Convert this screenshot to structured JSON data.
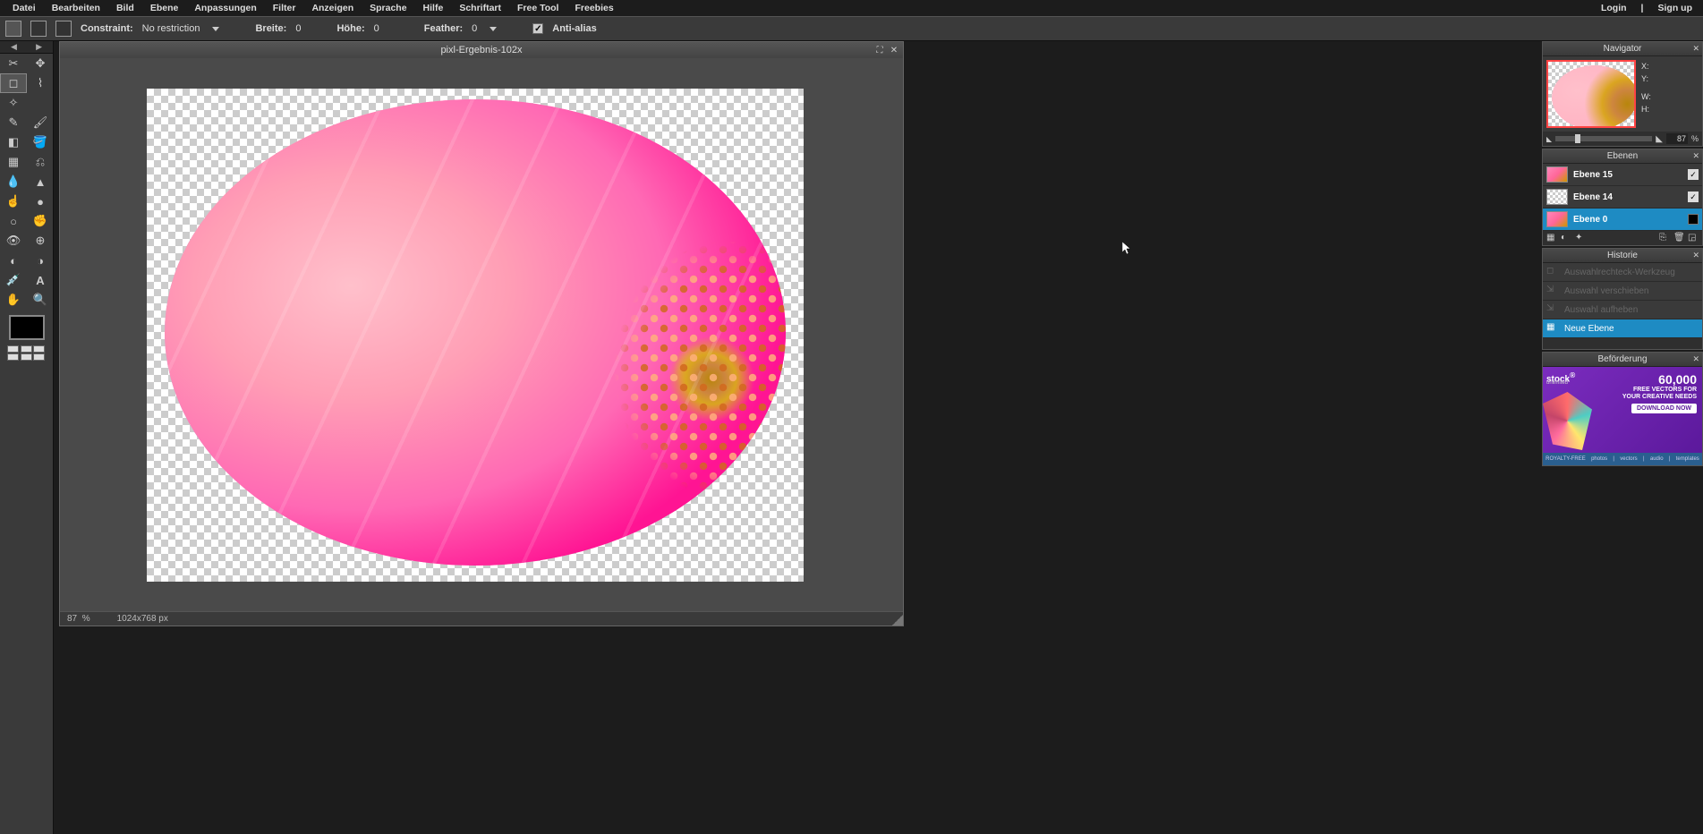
{
  "menubar": {
    "items": [
      "Datei",
      "Bearbeiten",
      "Bild",
      "Ebene",
      "Anpassungen",
      "Filter",
      "Anzeigen",
      "Sprache",
      "Hilfe",
      "Schriftart",
      "Free Tool",
      "Freebies"
    ],
    "login": "Login",
    "signup": "Sign up",
    "divider": "|"
  },
  "optionsbar": {
    "constraint_label": "Constraint:",
    "constraint_value": "No restriction",
    "width_label": "Breite:",
    "width_value": "0",
    "height_label": "Höhe:",
    "height_value": "0",
    "feather_label": "Feather:",
    "feather_value": "0",
    "antialias_label": "Anti-alias"
  },
  "document": {
    "title": "pixl-Ergebnis-102x",
    "zoom": "87",
    "zoom_unit": "%",
    "dimensions": "1024x768 px"
  },
  "panels": {
    "navigator": {
      "title": "Navigator",
      "x_label": "X:",
      "y_label": "Y:",
      "w_label": "W:",
      "h_label": "H:",
      "zoom": "87",
      "zoom_unit": "%"
    },
    "layers": {
      "title": "Ebenen",
      "items": [
        {
          "name": "Ebene 15",
          "visible": true,
          "selected": false,
          "thumb": "pink"
        },
        {
          "name": "Ebene 14",
          "visible": true,
          "selected": false,
          "thumb": "transparent"
        },
        {
          "name": "Ebene 0",
          "visible": true,
          "selected": true,
          "thumb": "pink",
          "solid": true
        }
      ]
    },
    "history": {
      "title": "Historie",
      "items": [
        {
          "label": "Auswahlrechteck-Werkzeug",
          "active": false
        },
        {
          "label": "Auswahl verschieben",
          "active": false
        },
        {
          "label": "Auswahl aufheben",
          "active": false
        },
        {
          "label": "Neue Ebene",
          "active": true
        }
      ]
    },
    "promo": {
      "title": "Beförderung",
      "brand": "stock",
      "brand_sub": "unlimited",
      "headline": "60,000",
      "sub1": "FREE VECTORS FOR",
      "sub2": "YOUR CREATIVE NEEDS",
      "button": "DOWNLOAD NOW",
      "footer": [
        "ROYALTY-FREE",
        "photos",
        "vectors",
        "audio",
        "templates"
      ]
    }
  },
  "tools": [
    "crop",
    "move",
    "marquee",
    "lasso",
    "wand",
    "",
    "pencil",
    "brush",
    "eraser",
    "bucket",
    "gradient",
    "clone",
    "blur",
    "sharpen",
    "smudge",
    "sponge",
    "dodge",
    "burn",
    "redeye",
    "spot",
    "bloat",
    "pinch",
    "picker",
    "text",
    "hand",
    "zoom"
  ]
}
